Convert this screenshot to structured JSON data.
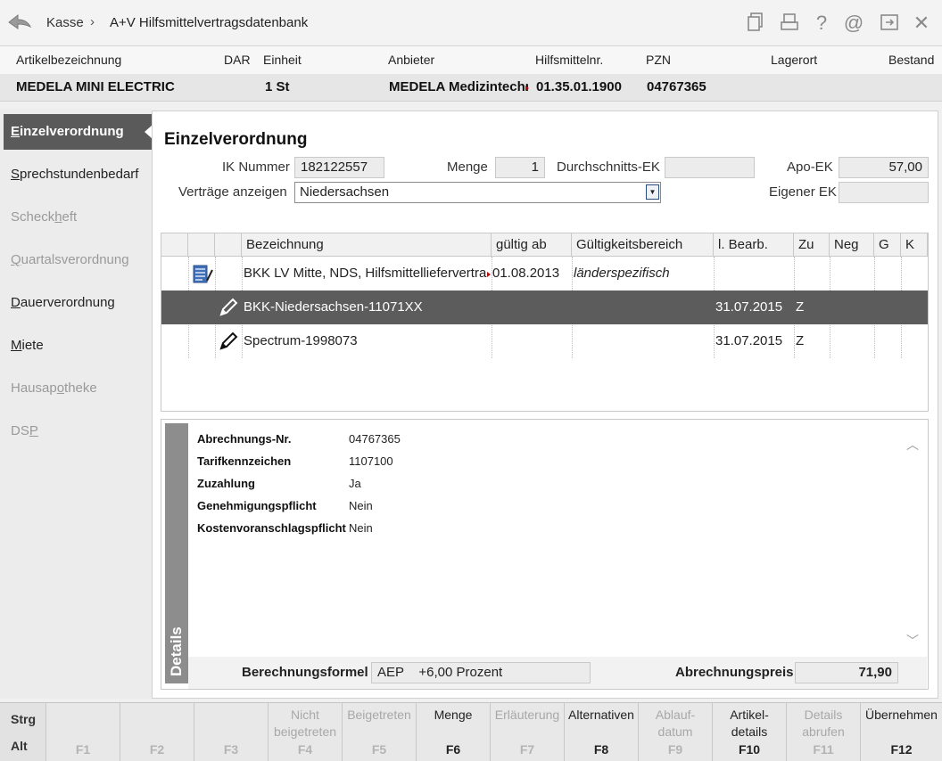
{
  "titlebar": {
    "crumb1": "Kasse",
    "separator": "›",
    "crumb2": "A+V Hilfsmittelvertragsdatenbank",
    "icons": [
      "document-copy-icon",
      "printer-icon",
      "help-icon",
      "at-icon",
      "export-window-icon",
      "close-icon"
    ],
    "icon_glyphs": {
      "help": "?",
      "at": "@",
      "close": "✕"
    }
  },
  "article": {
    "headers": {
      "bezeichnung": "Artikelbezeichnung",
      "dar": "DAR",
      "einheit": "Einheit",
      "anbieter": "Anbieter",
      "hmnr": "Hilfsmittelnr.",
      "pzn": "PZN",
      "lagerort": "Lagerort",
      "bestand": "Bestand"
    },
    "values": {
      "bezeichnung": "MEDELA MINI ELECTRIC",
      "dar": "",
      "einheit": "1 St",
      "anbieter": "MEDELA Medizintechn",
      "hmnr": "01.35.01.1900",
      "pzn": "04767365",
      "lagerort": "",
      "bestand": ""
    }
  },
  "sidebar": {
    "items": [
      {
        "first": "E",
        "rest": "inzelverordnung",
        "active": true
      },
      {
        "first": "S",
        "rest": "prechstundenbedarf",
        "active": false
      },
      {
        "pre": "Scheck",
        "first": "h",
        "rest": "eft",
        "disabled": true
      },
      {
        "first": "Q",
        "rest": "uartalsverordnung",
        "disabled": true
      },
      {
        "first": "D",
        "rest": "auerverordnung",
        "active": false
      },
      {
        "first": "M",
        "rest": "iete",
        "active": false
      },
      {
        "pre": "Hausap",
        "first": "o",
        "rest": "theke",
        "disabled": true
      },
      {
        "pre": "DS",
        "first": "P",
        "rest": "",
        "disabled": true
      }
    ]
  },
  "main": {
    "title": "Einzelverordnung",
    "ik_label": "IK Nummer",
    "ik_value": "182122557",
    "menge_label": "Menge",
    "menge_value": "1",
    "durchschnitt_label": "Durchschnitts-EK",
    "durchschnitt_value": "",
    "apoek_label": "Apo-EK",
    "apoek_value": "57,00",
    "vertraege_label": "Verträge anzeigen",
    "vertraege_value": "Niedersachsen",
    "eigenerek_label": "Eigener EK",
    "eigenerek_value": ""
  },
  "table": {
    "headers": [
      "Bezeichnung",
      "gültig ab",
      "Gültigkeitsbereich",
      "l. Bearb.",
      "Zu",
      "Neg",
      "G",
      "K"
    ],
    "rows": [
      {
        "icon": "contract-document-icon",
        "bezeichnung": "BKK LV Mitte, NDS, Hilfsmittelliefervertra",
        "gueltig": "01.08.2013",
        "bereich": "länderspezifisch",
        "bearb": "",
        "zu": "",
        "neg": "",
        "g": "",
        "k": ""
      },
      {
        "icon": "pencil-icon",
        "bezeichnung": "BKK-Niedersachsen-11071XX",
        "gueltig": "",
        "bereich": "",
        "bearb": "31.07.2015",
        "zu": "Z",
        "neg": "",
        "g": "",
        "k": "",
        "selected": true
      },
      {
        "icon": "pencil-icon",
        "bezeichnung": "Spectrum-1998073",
        "gueltig": "",
        "bereich": "",
        "bearb": "31.07.2015",
        "zu": "Z",
        "neg": "",
        "g": "",
        "k": ""
      }
    ]
  },
  "details": {
    "title": "Details",
    "items": [
      {
        "key": "Abrechnungs-Nr.",
        "value": "04767365"
      },
      {
        "key": "Tarifkennzeichen",
        "value": "1107100"
      },
      {
        "key": "Zuzahlung",
        "value": "Ja"
      },
      {
        "key": "Genehmigungspflicht",
        "value": "Nein"
      },
      {
        "key": "Kostenvoranschlagspflicht",
        "value": "Nein"
      }
    ],
    "formel_label": "Berechnungsformel",
    "formel_value": "AEP    +6,00 Prozent",
    "preis_label": "Abrechnungspreis",
    "preis_value": "71,90"
  },
  "fkeys": {
    "strg": "Strg",
    "alt": "Alt",
    "keys": [
      {
        "label": "",
        "key": "F1",
        "enabled": false
      },
      {
        "label": "",
        "key": "F2",
        "enabled": false
      },
      {
        "label": "",
        "key": "F3",
        "enabled": false
      },
      {
        "label": "Nicht\nbeigetreten",
        "key": "F4",
        "enabled": false
      },
      {
        "label": "Beigetreten",
        "key": "F5",
        "enabled": false
      },
      {
        "label": "Menge",
        "key": "F6",
        "enabled": true
      },
      {
        "label": "Erläuterung",
        "key": "F7",
        "enabled": false
      },
      {
        "label": "Alternativen",
        "key": "F8",
        "enabled": true
      },
      {
        "label": "Ablauf-\ndatum",
        "key": "F9",
        "enabled": false
      },
      {
        "label": "Artikel-\ndetails",
        "key": "F10",
        "enabled": true
      },
      {
        "label": "Details\nabrufen",
        "key": "F11",
        "enabled": false
      },
      {
        "label": "Übernehmen",
        "key": "F12",
        "enabled": true
      }
    ]
  }
}
